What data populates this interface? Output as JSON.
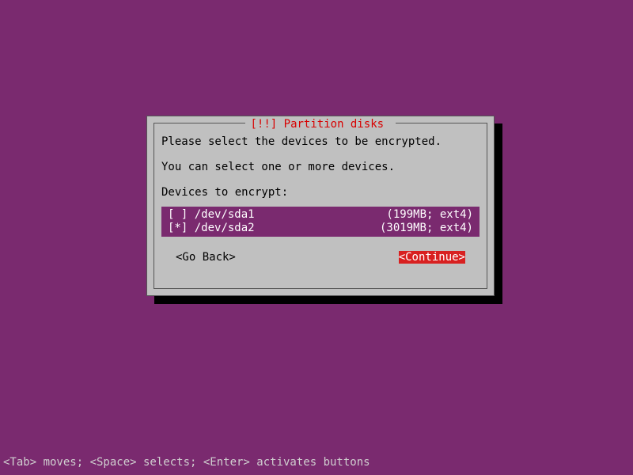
{
  "dialog": {
    "title_prefix": "[!!] ",
    "title_text": "Partition disks",
    "line1": "Please select the devices to be encrypted.",
    "line2": "You can select one or more devices.",
    "line3": "Devices to encrypt:",
    "devices": [
      {
        "checkbox": "[ ]",
        "path": "/dev/sda1",
        "info": "(199MB; ext4)"
      },
      {
        "checkbox": "[*]",
        "path": "/dev/sda2",
        "info": "(3019MB; ext4)"
      }
    ],
    "go_back": "<Go Back>",
    "continue": "<Continue>"
  },
  "footer": "<Tab> moves; <Space> selects; <Enter> activates buttons"
}
